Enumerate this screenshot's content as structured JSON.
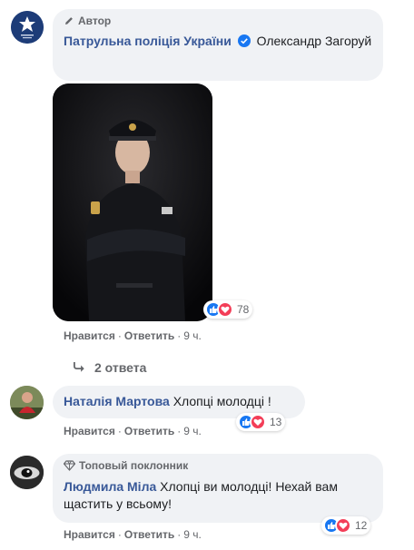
{
  "comments": [
    {
      "badge": "Автор",
      "author": "Патрульна поліція України",
      "verified": true,
      "text": "Олександр Загоруй",
      "reactions": "78",
      "actions": {
        "like": "Нравится",
        "reply": "Ответить",
        "time": "9 ч."
      },
      "replies_link": "2 ответа"
    },
    {
      "author": "Наталія Мартова",
      "text": "Хлопці молодці !",
      "reactions": "13",
      "actions": {
        "like": "Нравится",
        "reply": "Ответить",
        "time": "9 ч."
      }
    },
    {
      "badge": "Топовый поклонник",
      "author": "Людмила Міла",
      "text": "Хлопці ви молодці! Нехай вам щастить у всьому!",
      "reactions": "12",
      "actions": {
        "like": "Нравится",
        "reply": "Ответить",
        "time": "9 ч."
      }
    }
  ],
  "colors": {
    "link": "#385898",
    "bubble": "#f0f2f5",
    "like": "#1877f2",
    "love": "#f33e58"
  },
  "icons": [
    "pencil-icon",
    "verified-icon",
    "diamond-icon",
    "reply-arrow-icon",
    "like-reaction-icon",
    "love-reaction-icon"
  ]
}
